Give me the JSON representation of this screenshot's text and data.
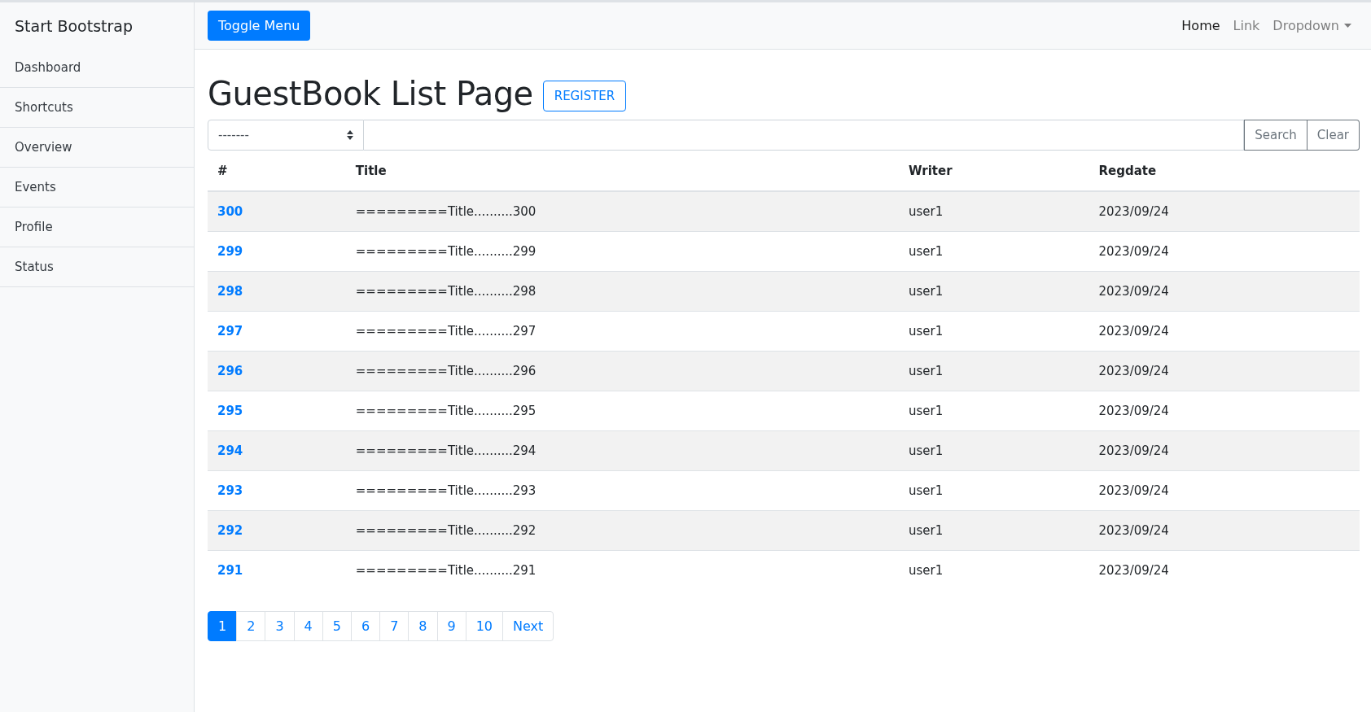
{
  "sidebar": {
    "brand": "Start Bootstrap",
    "items": [
      "Dashboard",
      "Shortcuts",
      "Overview",
      "Events",
      "Profile",
      "Status"
    ]
  },
  "topbar": {
    "toggle_button": "Toggle Menu",
    "nav": [
      {
        "label": "Home",
        "selected": true,
        "kind": "link"
      },
      {
        "label": "Link",
        "selected": false,
        "kind": "link"
      },
      {
        "label": "Dropdown",
        "selected": false,
        "kind": "dropdown"
      }
    ]
  },
  "heading": "GuestBook List Page",
  "register_button": "REGISTER",
  "search": {
    "select_value": "-------",
    "buttons": [
      "Search",
      "Clear"
    ]
  },
  "table": {
    "columns": [
      "#",
      "Title",
      "Writer",
      "Regdate"
    ],
    "rows": [
      [
        "300",
        "=========Title..........300",
        "user1",
        "2023/09/24"
      ],
      [
        "299",
        "=========Title..........299",
        "user1",
        "2023/09/24"
      ],
      [
        "298",
        "=========Title..........298",
        "user1",
        "2023/09/24"
      ],
      [
        "297",
        "=========Title..........297",
        "user1",
        "2023/09/24"
      ],
      [
        "296",
        "=========Title..........296",
        "user1",
        "2023/09/24"
      ],
      [
        "295",
        "=========Title..........295",
        "user1",
        "2023/09/24"
      ],
      [
        "294",
        "=========Title..........294",
        "user1",
        "2023/09/24"
      ],
      [
        "293",
        "=========Title..........293",
        "user1",
        "2023/09/24"
      ],
      [
        "292",
        "=========Title..........292",
        "user1",
        "2023/09/24"
      ],
      [
        "291",
        "=========Title..........291",
        "user1",
        "2023/09/24"
      ]
    ]
  },
  "pagination": [
    {
      "label": "1",
      "selected": true
    },
    {
      "label": "2",
      "selected": false
    },
    {
      "label": "3",
      "selected": false
    },
    {
      "label": "4",
      "selected": false
    },
    {
      "label": "5",
      "selected": false
    },
    {
      "label": "6",
      "selected": false
    },
    {
      "label": "7",
      "selected": false
    },
    {
      "label": "8",
      "selected": false
    },
    {
      "label": "9",
      "selected": false
    },
    {
      "label": "10",
      "selected": false
    },
    {
      "label": "Next",
      "selected": false
    }
  ]
}
